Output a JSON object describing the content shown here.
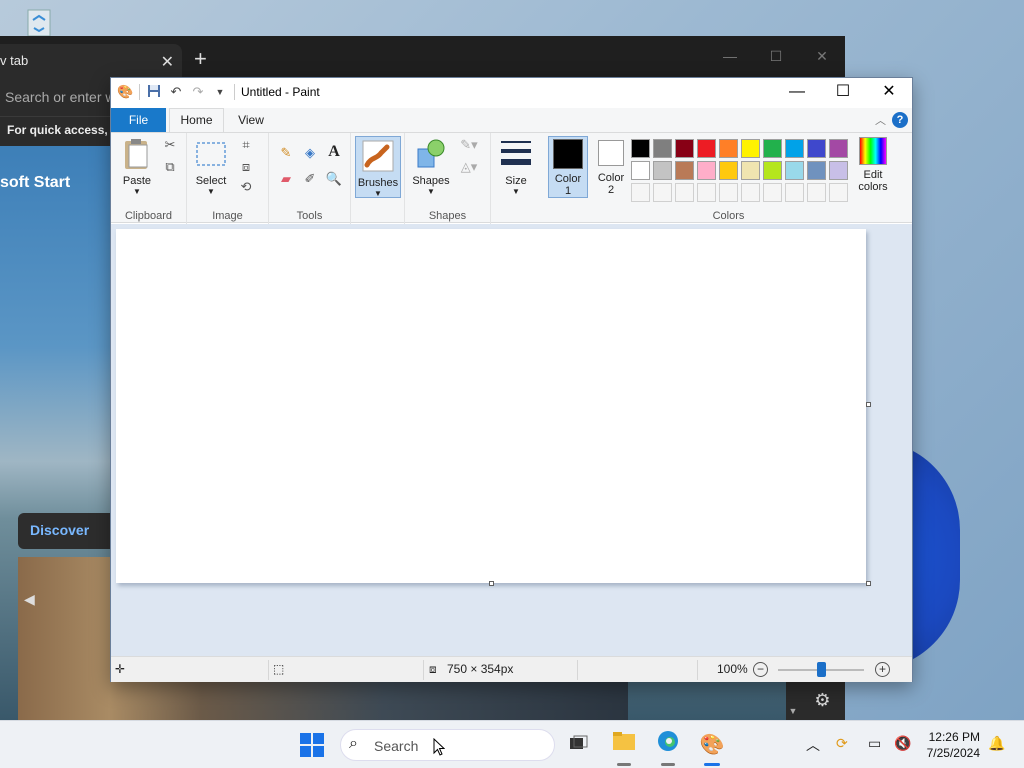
{
  "browser": {
    "tab_title": "v tab",
    "address_placeholder": "Search or enter w",
    "favorites_text": "For quick access, p",
    "start_text": "soft Start",
    "discover_label": "Discover"
  },
  "paint": {
    "title": "Untitled - Paint",
    "tabs": {
      "file": "File",
      "home": "Home",
      "view": "View"
    },
    "groups": {
      "clipboard": "Clipboard",
      "image": "Image",
      "tools": "Tools",
      "shapes": "Shapes",
      "colors": "Colors"
    },
    "buttons": {
      "paste": "Paste",
      "select": "Select",
      "brushes": "Brushes",
      "shapes": "Shapes",
      "size": "Size",
      "color1": "Color\n1",
      "color2": "Color\n2",
      "edit_colors": "Edit\ncolors"
    },
    "status": {
      "canvas_size": "750 × 354px",
      "zoom": "100%"
    },
    "palette_row1": [
      "#000000",
      "#7f7f7f",
      "#880015",
      "#ed1c24",
      "#ff7f27",
      "#fff200",
      "#22b14c",
      "#00a2e8",
      "#3f48cc",
      "#a349a4"
    ],
    "palette_row2": [
      "#ffffff",
      "#c3c3c3",
      "#b97a57",
      "#ffaec9",
      "#ffc90e",
      "#efe4b0",
      "#b5e61d",
      "#99d9ea",
      "#7092be",
      "#c8bfe7"
    ],
    "palette_row3": [
      "#f5f5f5",
      "#f5f5f5",
      "#f5f5f5",
      "#f5f5f5",
      "#f5f5f5",
      "#f5f5f5",
      "#f5f5f5",
      "#f5f5f5",
      "#f5f5f5",
      "#f5f5f5"
    ],
    "color1": "#000000",
    "color2": "#ffffff"
  },
  "taskbar": {
    "search_placeholder": "Search",
    "time": "12:26 PM",
    "date": "7/25/2024"
  }
}
